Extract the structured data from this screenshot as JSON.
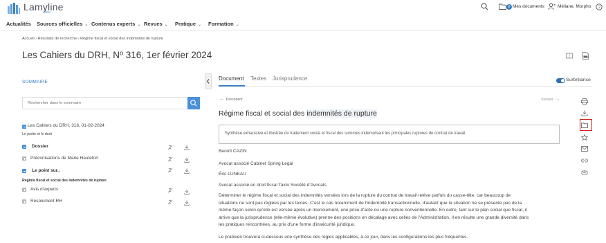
{
  "app": {
    "name": "Lamyline",
    "tagline": "New"
  },
  "header": {
    "my_documents": "Mes documents",
    "documents_count": "0",
    "user_name": "Méliane, Morpho",
    "icons": [
      "search-icon",
      "folder-icon",
      "user-icon",
      "help-icon"
    ]
  },
  "nav": {
    "items": [
      {
        "label": "Actualités",
        "has_dropdown": false
      },
      {
        "label": "Sources officielles",
        "has_dropdown": true
      },
      {
        "label": "Contenus experts",
        "has_dropdown": true
      },
      {
        "label": "Revues",
        "has_dropdown": true
      },
      {
        "label": "Pratique",
        "has_dropdown": true
      },
      {
        "label": "Formation",
        "has_dropdown": true
      }
    ]
  },
  "breadcrumb": "Accueil › Résultats de recherche › Régime fiscal et social des indemnités de rupture",
  "page_title": "Les Cahiers du DRH, Nº 316, 1er février 2024",
  "sidebar": {
    "title": "SOMMAIRE",
    "search_placeholder": "Rechercher dans le sommaire",
    "root": {
      "label": "Les Cahiers du DRH, 316, 01-02-2024",
      "sub": "Le poète et le droit"
    },
    "items": [
      {
        "label": "Dossier"
      },
      {
        "label": "Préconisations de Marie Hautefort"
      },
      {
        "label": "Le point sur.."
      },
      {
        "label": "Régime fiscal et social des indemnités de rupture"
      },
      {
        "label": "Avis d'experts"
      },
      {
        "label": "Résolument RH"
      }
    ]
  },
  "tabs": [
    {
      "label": "Document",
      "active": true
    },
    {
      "label": "Textes",
      "active": false
    },
    {
      "label": "Jurisprudence",
      "active": false
    }
  ],
  "surbrillance": {
    "label": "Surbrillance",
    "on": true
  },
  "pager": {
    "prev": "Précédent",
    "next": "Suivant"
  },
  "document": {
    "title_plain": "Régime fiscal et social des ",
    "title_highlight": "indemnités de rupture",
    "synthesis": "Synthèse exhaustive et illustrée du traitement social et fiscal des sommes indemnisant les principales ruptures de contrat de travail.",
    "authors": [
      "Benoît CAZIN",
      "Avocat associé Cabinet Spring Legal",
      "Éric LUNEAU",
      "Avocat associé en droit fiscal Taxlo Société d'Avocats"
    ],
    "paragraph_lines": [
      "Déterminer le régime fiscal et social des indemnités versées lors de la rupture du contrat de travail relève parfois du casse-tête, car beaucoup de",
      "situations ne sont pas réglées par les textes. C'est le cas notamment de l'indemnité transactionnelle, d'autant que la situation ne se présente pas de la",
      "même façon selon qu'elle est versée après un licenciement, une prise d'acte ou une rupture conventionnelle. En outre, tant sur le plan social que fiscal, il",
      "arrive que la jurisprudence (elle-même évolutive) prenne des positions en décalage avec celles de l'Administration. Il en résulte une grande diversité dans",
      "les pratiques rencontrées, au prix d'une forme d'insécurité juridique."
    ],
    "last_line": "Le praticien trouvera ci-dessous une synthèse des règles applicables, à ce jour, dans les configurations les plus fréquentes."
  },
  "side_tools": [
    "print-icon",
    "download-icon",
    "folder-icon",
    "star-icon",
    "mail-icon",
    "link-icon",
    "share-icon"
  ],
  "colors": {
    "accent": "#3a7fc4",
    "highlight_box": "#d42020"
  }
}
